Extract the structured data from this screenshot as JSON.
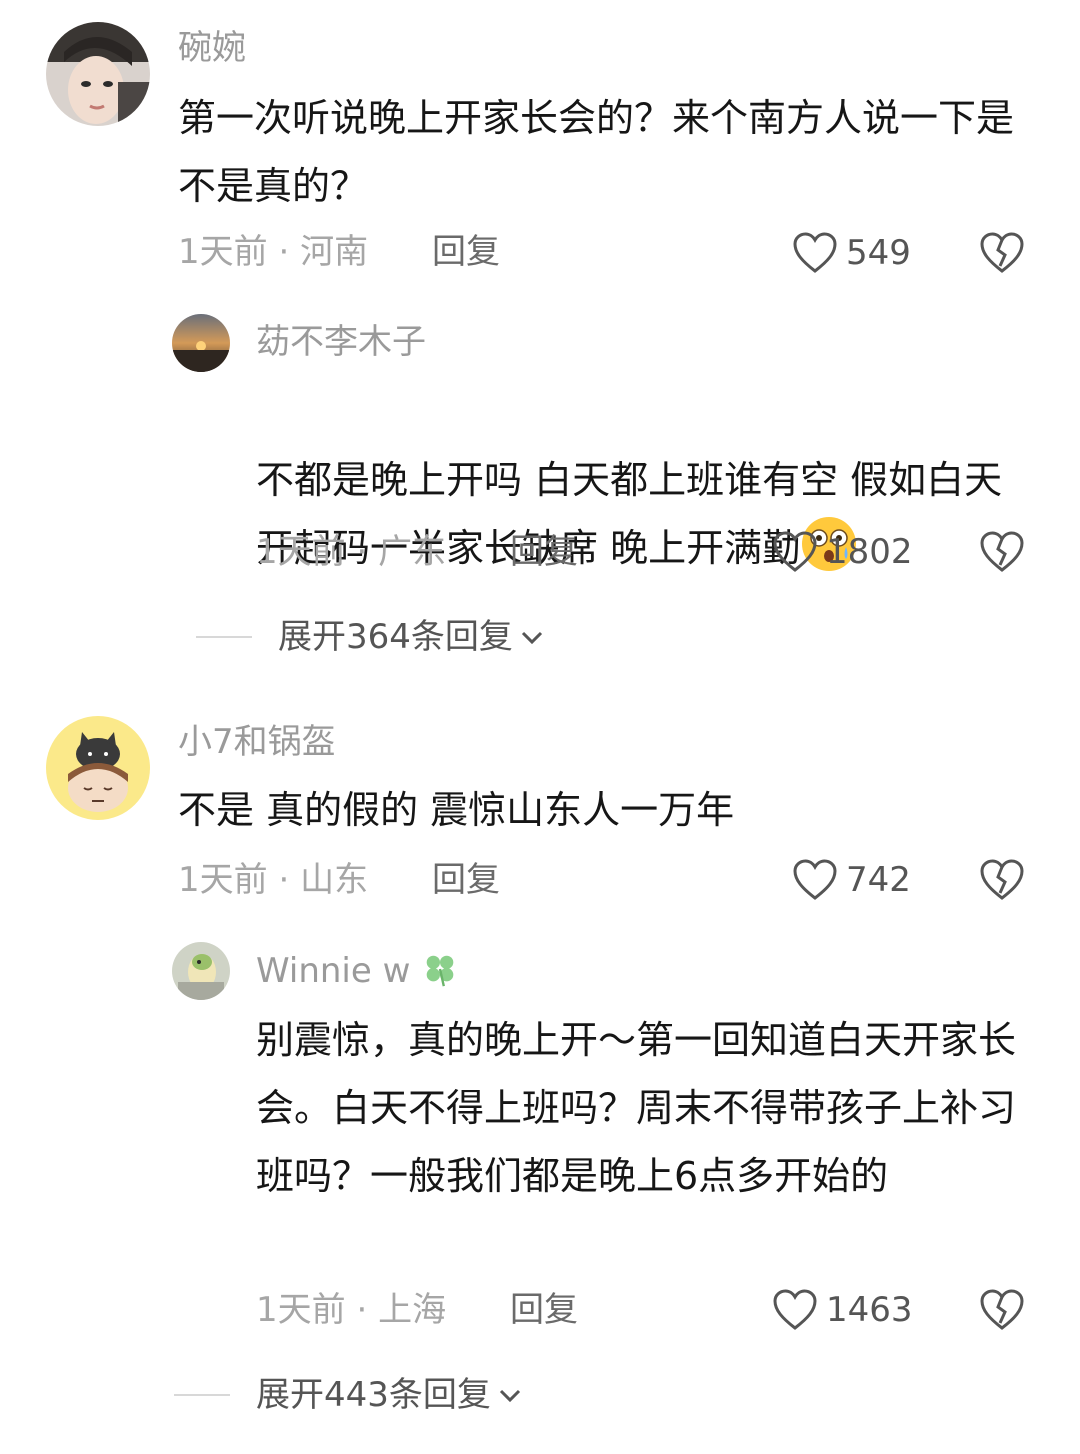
{
  "comments": [
    {
      "username": "碗婉",
      "text": "第一次听说晚上开家长会的？来个南方人说一下是不是真的？",
      "time": "1天前",
      "location": "河南",
      "reply_label": "回复",
      "likes": "549",
      "replies": [
        {
          "username": "苭不李木子",
          "text": "不都是晚上开吗 白天都上班谁有空 假如白天开起码一半家长缺席 晚上开满勤",
          "time": "1天前",
          "location": "广东",
          "reply_label": "回复",
          "likes": "1802"
        }
      ],
      "expand_label": "展开364条回复"
    },
    {
      "username": "小7和锅盔",
      "text": "不是 真的假的 震惊山东人一万年",
      "time": "1天前",
      "location": "山东",
      "reply_label": "回复",
      "likes": "742",
      "replies": [
        {
          "username": "Winnie w",
          "text": "别震惊，真的晚上开～第一回知道白天开家长会。白天不得上班吗？周末不得带孩子上补习班吗？一般我们都是晚上6点多开始的",
          "time": "1天前",
          "location": "上海",
          "reply_label": "回复",
          "likes": "1463"
        }
      ],
      "expand_label": "展开443条回复"
    }
  ],
  "meta_separator": " · ",
  "icons": {
    "like": "heart-outline-icon",
    "dislike": "broken-heart-icon",
    "expand": "chevron-down-icon",
    "username_emoji": "four-leaf-clover-icon",
    "text_emoji": "shocked-face-emoji"
  }
}
